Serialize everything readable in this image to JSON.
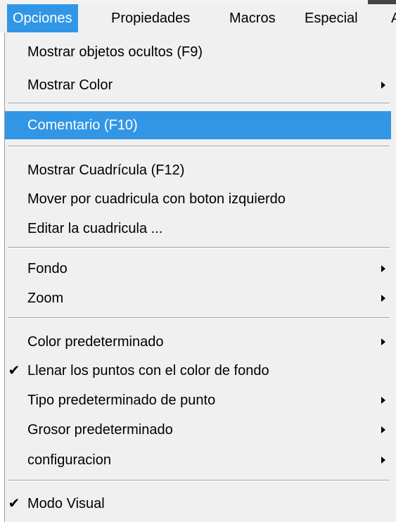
{
  "menubar": {
    "items": [
      {
        "label": "Opciones",
        "active": true
      },
      {
        "label": "Propiedades"
      },
      {
        "label": "Macros"
      },
      {
        "label": "Especial"
      },
      {
        "label": "A"
      }
    ]
  },
  "menu": {
    "items": [
      {
        "label": "Mostrar objetos ocultos (F9)"
      },
      {
        "label": "Mostrar Color",
        "submenu": true
      },
      {
        "label": "Comentario (F10)",
        "highlighted": true
      },
      {
        "label": "Mostrar Cuadrícula (F12)"
      },
      {
        "label": "Mover por cuadricula con boton izquierdo"
      },
      {
        "label": "Editar la cuadricula ..."
      },
      {
        "label": "Fondo",
        "submenu": true
      },
      {
        "label": "Zoom",
        "submenu": true
      },
      {
        "label": "Color predeterminado",
        "submenu": true
      },
      {
        "label": "Llenar los puntos con el color de fondo",
        "checked": true,
        "check": "✔"
      },
      {
        "label": "Tipo predeterminado de punto",
        "submenu": true
      },
      {
        "label": "Grosor predeterminado",
        "submenu": true
      },
      {
        "label": "configuracion",
        "submenu": true
      },
      {
        "label": "Modo Visual",
        "checked": true,
        "check": "✔"
      }
    ]
  },
  "colors": {
    "highlight": "#3296e6",
    "menu_bg": "#f0f0f0"
  }
}
